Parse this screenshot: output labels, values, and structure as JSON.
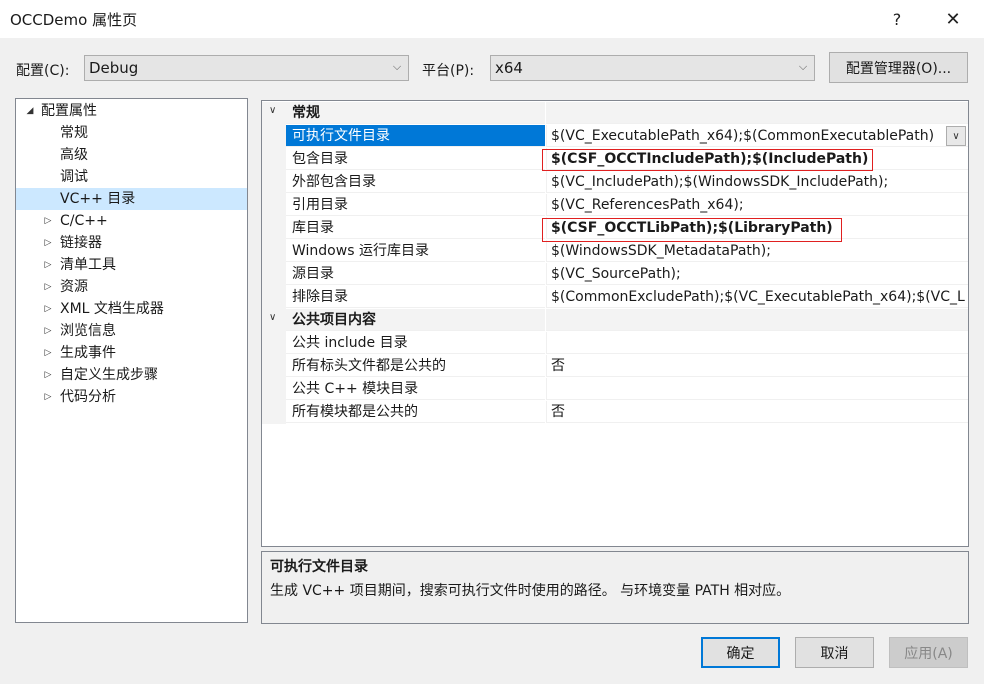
{
  "window": {
    "title": "OCCDemo 属性页",
    "help_label": "?",
    "close_label": "✕"
  },
  "config_bar": {
    "config_label": "配置(C):",
    "config_value": "Debug",
    "platform_label": "平台(P):",
    "platform_value": "x64",
    "manager_button": "配置管理器(O)..."
  },
  "tree": {
    "root": "配置属性",
    "items": [
      {
        "label": "常规"
      },
      {
        "label": "高级"
      },
      {
        "label": "调试"
      },
      {
        "label": "VC++ 目录",
        "selected": true
      },
      {
        "label": "C/C++",
        "expandable": true
      },
      {
        "label": "链接器",
        "expandable": true
      },
      {
        "label": "清单工具",
        "expandable": true
      },
      {
        "label": "资源",
        "expandable": true
      },
      {
        "label": "XML 文档生成器",
        "expandable": true
      },
      {
        "label": "浏览信息",
        "expandable": true
      },
      {
        "label": "生成事件",
        "expandable": true
      },
      {
        "label": "自定义生成步骤",
        "expandable": true
      },
      {
        "label": "代码分析",
        "expandable": true
      }
    ]
  },
  "grid": {
    "category_general": "常规",
    "general_rows": [
      {
        "name": "可执行文件目录",
        "value": "$(VC_ExecutablePath_x64);$(CommonExecutablePath)"
      },
      {
        "name": "包含目录",
        "value": "$(CSF_OCCTIncludePath);$(IncludePath)"
      },
      {
        "name": "外部包含目录",
        "value": "$(VC_IncludePath);$(WindowsSDK_IncludePath);"
      },
      {
        "name": "引用目录",
        "value": "$(VC_ReferencesPath_x64);"
      },
      {
        "name": "库目录",
        "value": "$(CSF_OCCTLibPath);$(LibraryPath)"
      },
      {
        "name": "Windows 运行库目录",
        "value": "$(WindowsSDK_MetadataPath);"
      },
      {
        "name": "源目录",
        "value": "$(VC_SourcePath);"
      },
      {
        "name": "排除目录",
        "value": "$(CommonExcludePath);$(VC_ExecutablePath_x64);$(VC_L"
      }
    ],
    "category_public": "公共项目内容",
    "public_rows": [
      {
        "name": "公共 include 目录",
        "value": ""
      },
      {
        "name": "所有标头文件都是公共的",
        "value": "否"
      },
      {
        "name": "公共 C++ 模块目录",
        "value": ""
      },
      {
        "name": "所有模块都是公共的",
        "value": "否"
      }
    ]
  },
  "description": {
    "title": "可执行文件目录",
    "text": "生成 VC++ 项目期间，搜索可执行文件时使用的路径。 与环境变量 PATH 相对应。"
  },
  "buttons": {
    "ok": "确定",
    "cancel": "取消",
    "apply": "应用(A)"
  },
  "colors": {
    "selection": "#0078d7",
    "tree_selection": "#cce8ff",
    "highlight_box": "#e02020",
    "primary_border": "#0078d7"
  }
}
